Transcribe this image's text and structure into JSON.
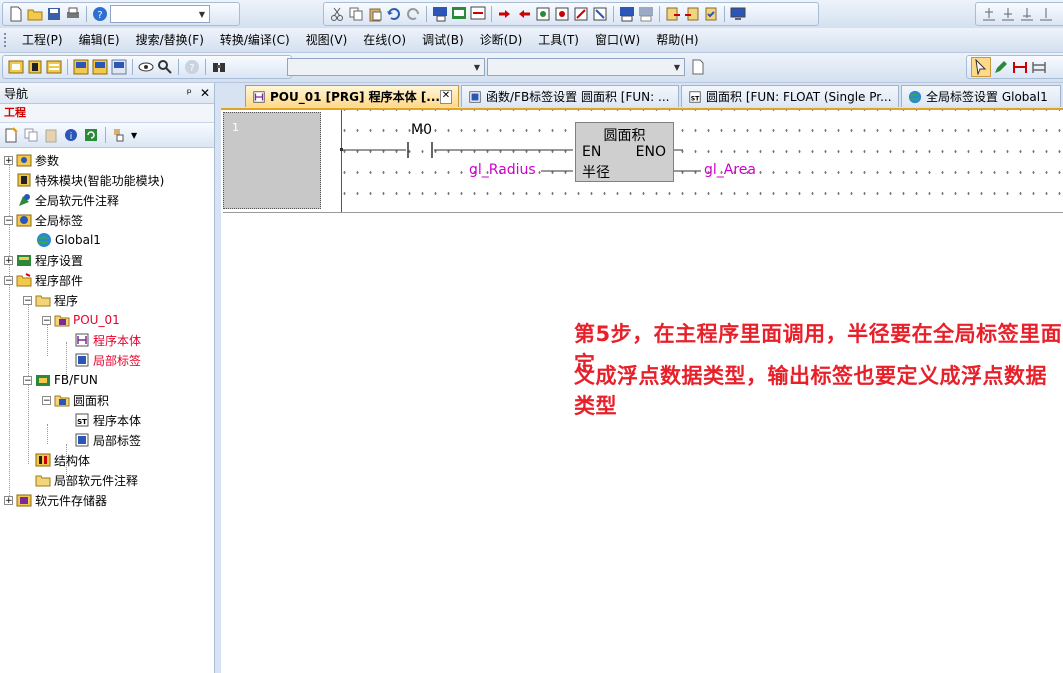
{
  "toolbar": {
    "combo_empty": "",
    "combo_disabled_1": "",
    "combo_disabled_2": ""
  },
  "menu": {
    "items": [
      "工程(P)",
      "编辑(E)",
      "搜索/替换(F)",
      "转换/编译(C)",
      "视图(V)",
      "在线(O)",
      "调试(B)",
      "诊断(D)",
      "工具(T)",
      "窗口(W)",
      "帮助(H)"
    ]
  },
  "nav": {
    "title": "导航",
    "pin_glyph": "ᵖ",
    "close_glyph": "✕",
    "section": "工程",
    "tree": [
      {
        "label": "参数"
      },
      {
        "label": "特殊模块(智能功能模块)"
      },
      {
        "label": "全局软元件注释"
      },
      {
        "label": "全局标签"
      },
      {
        "label": "Global1"
      },
      {
        "label": "程序设置"
      },
      {
        "label": "程序部件"
      },
      {
        "label": "程序"
      },
      {
        "label": "POU_01"
      },
      {
        "label": "程序本体"
      },
      {
        "label": "局部标签"
      },
      {
        "label": "FB/FUN"
      },
      {
        "label": "圆面积"
      },
      {
        "label": "程序本体"
      },
      {
        "label": "局部标签"
      },
      {
        "label": "结构体"
      },
      {
        "label": "局部软元件注释"
      },
      {
        "label": "软元件存储器"
      }
    ]
  },
  "tabs": [
    {
      "label": "POU_01 [PRG] 程序本体 [...",
      "active": true,
      "close": "✕"
    },
    {
      "label": "函数/FB标签设置 圆面积 [FUN: ..."
    },
    {
      "label": "圆面积 [FUN: FLOAT (Single Pr..."
    },
    {
      "label": "全局标签设置 Global1"
    }
  ],
  "editor": {
    "step_number": "1",
    "contact": "M0",
    "fb_name": "圆面积",
    "en": "EN",
    "eno": "ENO",
    "input_pin": "半径",
    "input_label": "gl_Radius",
    "output_label": "gl_Area"
  },
  "annotation": {
    "line1": "第5步，在主程序里面调用，半径要在全局标签里面定",
    "line2": "义成浮点数据类型，输出标签也要定义成浮点数据类型"
  },
  "colors": {
    "accent_tab": "#ffd98a",
    "annotation": "#e8202a",
    "label_magenta": "#d000d0",
    "tree_red": "#e8002c"
  }
}
